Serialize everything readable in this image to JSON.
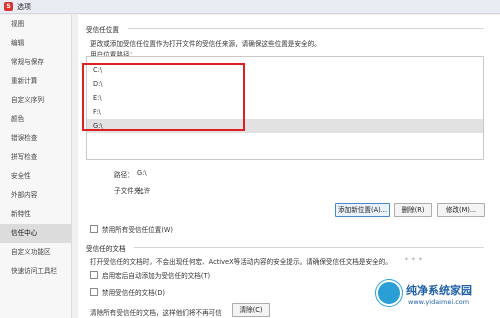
{
  "window": {
    "title": "选项"
  },
  "sidebar": {
    "items": [
      {
        "label": "视图"
      },
      {
        "label": "编辑"
      },
      {
        "label": "常规与保存"
      },
      {
        "label": "重新计算"
      },
      {
        "label": "自定义序列"
      },
      {
        "label": "颜色"
      },
      {
        "label": "错误检查"
      },
      {
        "label": "拼写检查"
      },
      {
        "label": "安全性"
      },
      {
        "label": "外部内容"
      },
      {
        "label": "新特性"
      },
      {
        "label": "信任中心"
      },
      {
        "label": "自定义功能区"
      },
      {
        "label": "快速访问工具栏"
      }
    ],
    "active_index": 11
  },
  "trusted_locations": {
    "group_title": "受信任位置",
    "description": "更改或添加受信任位置作为打开文件的受信任来源，请确保这些位置是安全的。",
    "list_label": "用户位置路径：",
    "paths": [
      "C:\\",
      "D:\\",
      "E:\\",
      "F:\\",
      "G:\\"
    ],
    "selected_path": "G:\\",
    "path_label": "路径：",
    "path_value": "G:\\",
    "subfolders_label": "子文件夹：",
    "subfolders_value": "允许",
    "add_button": "添加新位置(A)...",
    "delete_button": "删除(R)",
    "modify_button": "修改(M)...",
    "disable_all_label": "禁用所有受信任位置(W)"
  },
  "trusted_documents": {
    "group_title": "受信任的文档",
    "description": "打开受信任的文档时，不会出现任何宏、ActiveX等活动内容的安全提示。请确保受信任文档是安全的。",
    "enable_macro_label": "启用宏后自动添加为受信任的文档(T)",
    "disable_trusted_label": "禁用受信任的文档(D)",
    "clear_desc": "清除所有受信任的文档，这样他们将不再可信",
    "clear_button": "清除(C)"
  },
  "watermark": {
    "text": "纯净系统家园",
    "url": "www.yidaimei.com"
  }
}
